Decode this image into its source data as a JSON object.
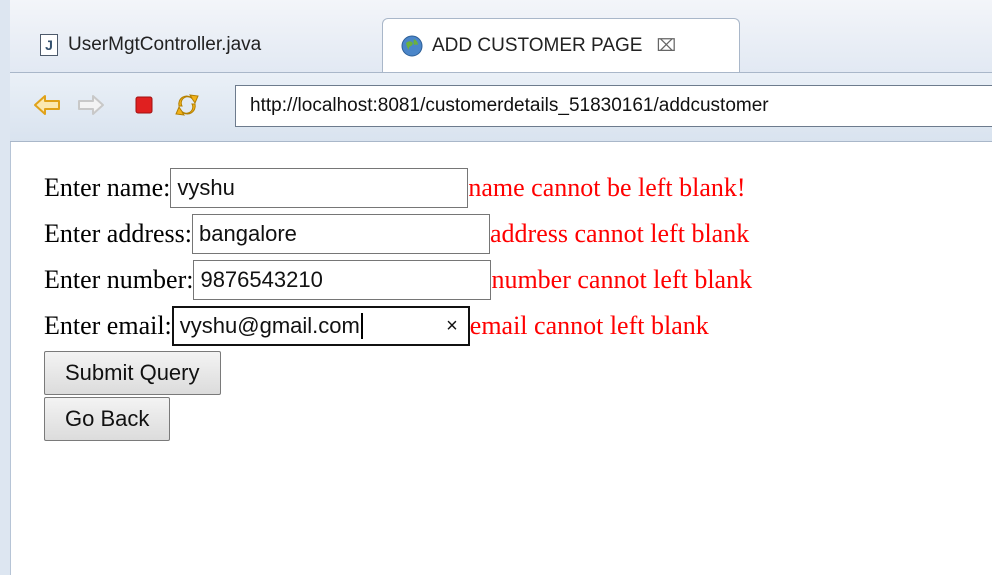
{
  "tabs": [
    {
      "label": "UserMgtController.java",
      "icon": "java-file-icon"
    },
    {
      "label": "ADD CUSTOMER PAGE",
      "icon": "globe-icon",
      "close": "⌧"
    }
  ],
  "toolbar": {
    "url": "http://localhost:8081/customerdetails_51830161/addcustomer"
  },
  "form": {
    "name": {
      "label": "Enter name:",
      "value": "vyshu",
      "error": "name cannot be left blank!"
    },
    "address": {
      "label": "Enter address:",
      "value": "bangalore",
      "error": "address cannot left blank"
    },
    "number": {
      "label": "Enter number:",
      "value": "9876543210",
      "error": "number cannot left blank"
    },
    "email": {
      "label": "Enter email:",
      "value": "vyshu@gmail.com",
      "clear": "×",
      "error": "email cannot left blank"
    },
    "submit_label": "Submit Query",
    "back_label": "Go Back"
  },
  "colors": {
    "error": "#ff0000",
    "accent_back_arrow": "#f2b21b",
    "stop": "#e02020"
  }
}
